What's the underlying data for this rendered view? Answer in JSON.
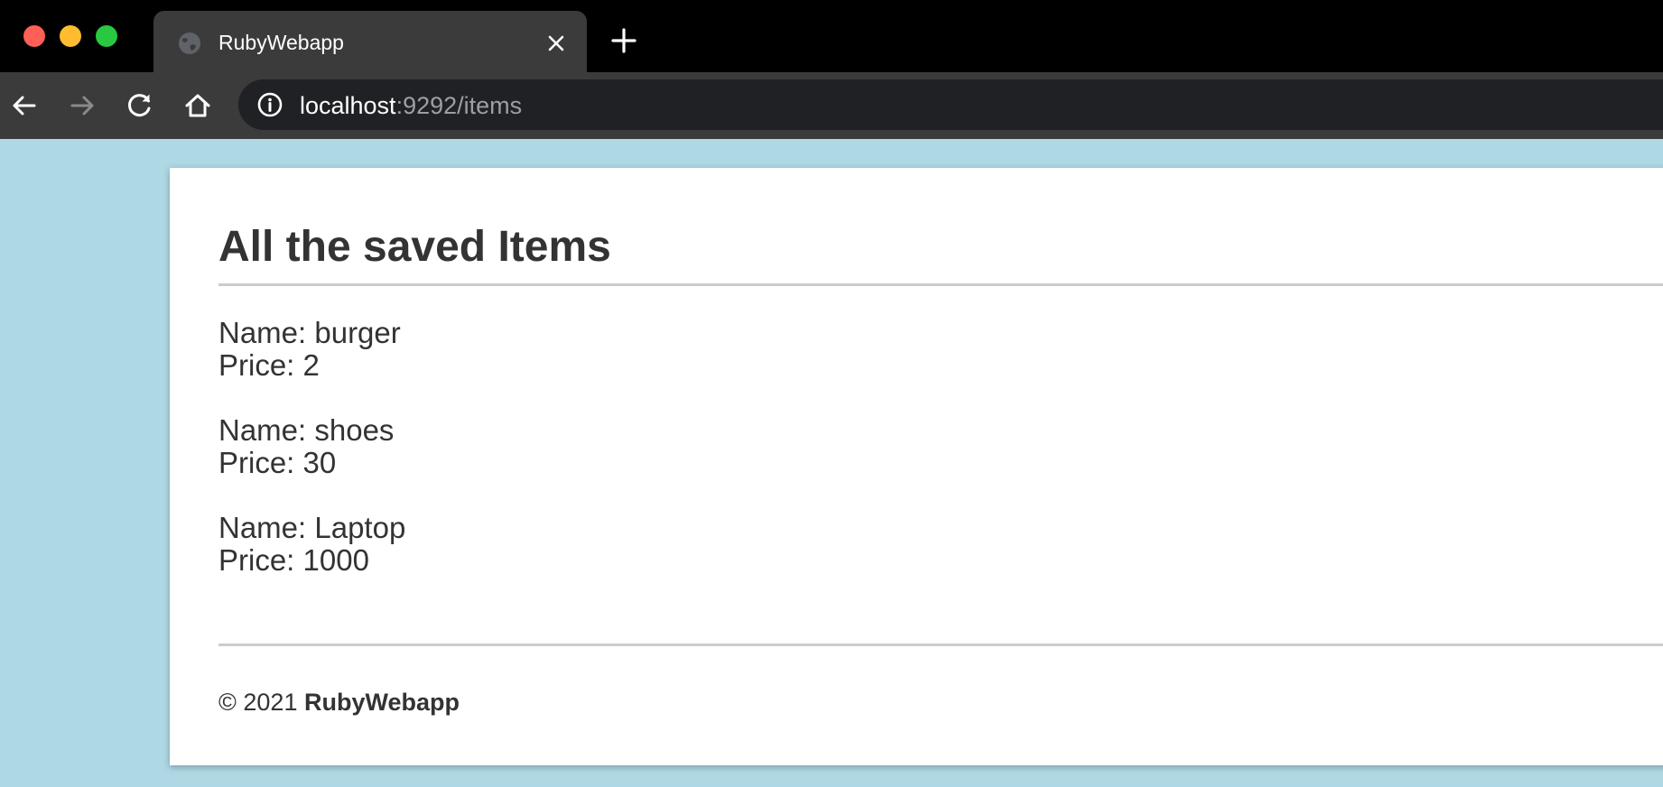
{
  "browser": {
    "tab": {
      "title": "RubyWebapp",
      "favicon": "globe-icon"
    },
    "address_bar": {
      "host": "localhost",
      "rest": ":9292/items",
      "icon": "info-icon"
    },
    "colors": {
      "tabbar": "#000000",
      "toolbar": "#3b3b3c",
      "omnibox": "#202124",
      "close": "#ff5f57",
      "minimize": "#febc2e",
      "maximize": "#28c840"
    }
  },
  "page": {
    "title": "All the saved Items",
    "items": [
      {
        "name": "Name: burger",
        "price": "Price: 2"
      },
      {
        "name": "Name: shoes",
        "price": "Price: 30"
      },
      {
        "name": "Name: Laptop",
        "price": "Price: 1000"
      }
    ],
    "footer": {
      "copyright": "© 2021 ",
      "brand": "RubyWebapp"
    },
    "colors": {
      "background": "#add8e4",
      "card": "#ffffff",
      "text": "#333333",
      "rule": "#cccccc"
    }
  }
}
